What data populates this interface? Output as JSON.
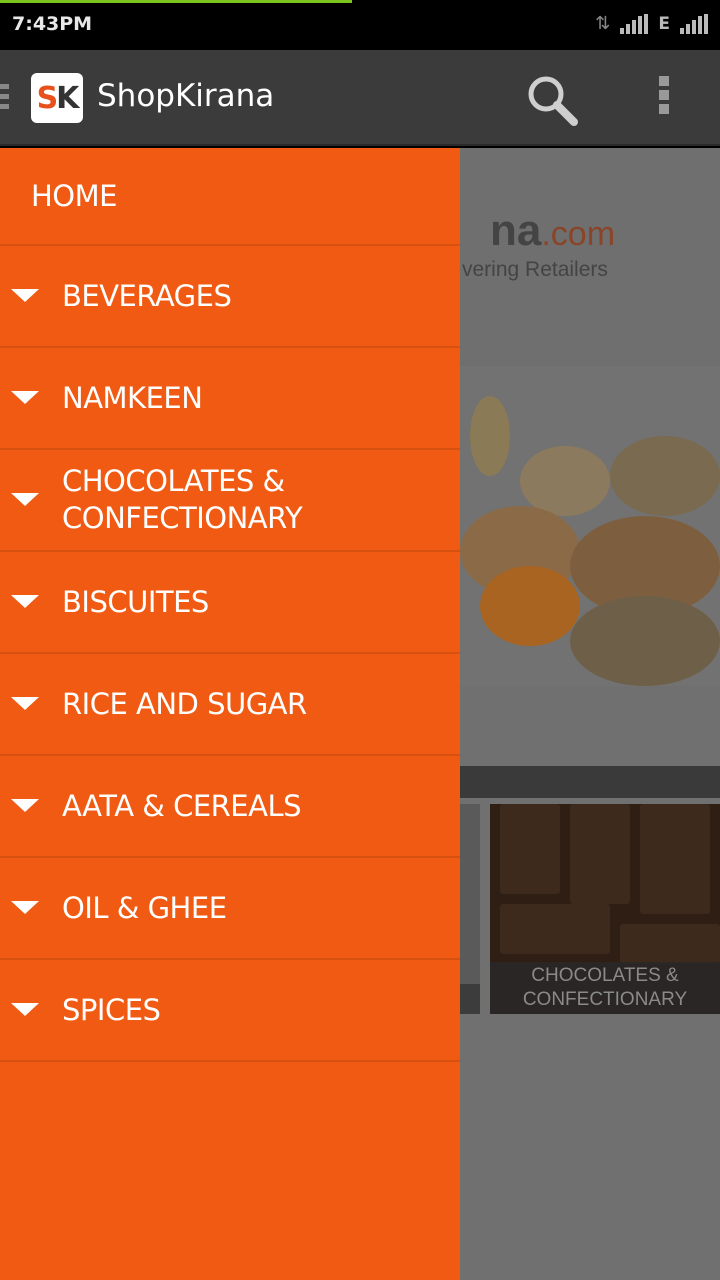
{
  "status_bar": {
    "time": "7:43PM",
    "network_type": "E",
    "colors": {
      "progress": "#7cc31d"
    }
  },
  "action_bar": {
    "logo_s": "S",
    "logo_k": "K",
    "title": "ShopKirana",
    "icons": [
      "drawer-indicator-icon",
      "search-icon",
      "overflow-menu-icon"
    ]
  },
  "background": {
    "banner_domain": "na",
    "banner_domain_suffix": ".com",
    "banner_tagline": "vering Retailers",
    "tile_caption_line1": "CHOCOLATES &",
    "tile_caption_line2": "CONFECTIONARY"
  },
  "drawer": {
    "accent_color": "#f15a12",
    "home_label": "HOME",
    "items": [
      {
        "line1": "BEVERAGES",
        "line2": ""
      },
      {
        "line1": "NAMKEEN",
        "line2": ""
      },
      {
        "line1": "CHOCOLATES &",
        "line2": "CONFECTIONARY"
      },
      {
        "line1": "BISCUITES",
        "line2": ""
      },
      {
        "line1": "RICE AND SUGAR",
        "line2": ""
      },
      {
        "line1": "AATA & CEREALS",
        "line2": ""
      },
      {
        "line1": "OIL & GHEE",
        "line2": ""
      },
      {
        "line1": "SPICES",
        "line2": ""
      }
    ]
  }
}
